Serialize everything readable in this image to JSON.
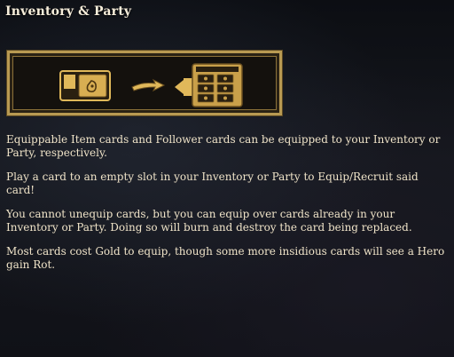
{
  "panel": {
    "title": "Inventory & Party"
  },
  "illustration": {
    "icons": [
      "card-icon",
      "arrow-icon",
      "inventory-grid-icon"
    ]
  },
  "paragraphs": [
    "Equippable Item cards and Follower cards can be equipped to your Inventory or Party, respectively.",
    "Play a card to an empty slot in your Inventory or Party to Equip/Recruit said card!",
    "You cannot unequip cards, but you can equip over cards already in your Inventory or Party. Doing so will burn and destroy the card being replaced.",
    "Most cards cost Gold to equip, though some more insidious cards will see a Hero gain Rot."
  ],
  "colors": {
    "gold": "#e0b85a",
    "frame": "#b89a52",
    "text": "#efe3c8"
  }
}
